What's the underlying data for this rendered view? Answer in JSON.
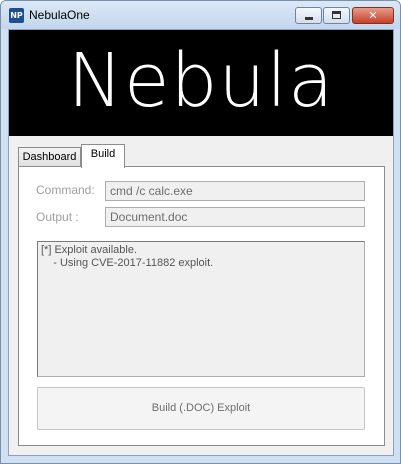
{
  "window": {
    "title": "NebulaOne",
    "icon_label": "NP",
    "icon": "app-icon",
    "controls": [
      "minimize-icon",
      "maximize-icon",
      "close-icon"
    ],
    "close_glyph": "✕"
  },
  "banner": {
    "text": "Nebula"
  },
  "tabs": [
    {
      "label": "Dashboard",
      "selected": false
    },
    {
      "label": "Build",
      "selected": true
    }
  ],
  "build": {
    "command_label": "Command:",
    "command_value": "cmd /c calc.exe",
    "output_label": "Output :",
    "output_value": "Document.doc",
    "log_lines": [
      "[*] Exploit available.",
      "    - Using CVE-2017-11882 exploit."
    ],
    "build_button_label": "Build (.DOC) Exploit"
  },
  "colors": {
    "titlebar": "#c3d6ec",
    "banner_background": "#000000",
    "banner_text": "#ffffff",
    "close_button": "#c4402a",
    "disabled_text": "#a0a0a0"
  }
}
